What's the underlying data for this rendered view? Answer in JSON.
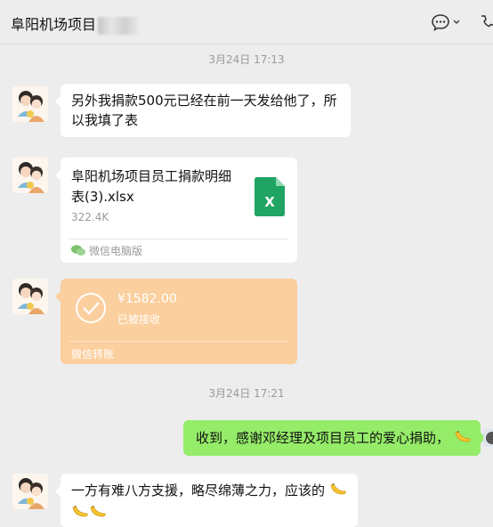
{
  "header": {
    "title": "阜阳机场项目",
    "title_hidden_suffix": "",
    "more_icon": "chat-bubble-more-icon",
    "extra_icon": "phone-icon"
  },
  "timestamps": [
    "3月24日 17:13",
    "3月24日 17:21"
  ],
  "messages": [
    {
      "text_line1": "另外我捐款500元已经在前一天发给他了，所",
      "text_line2": "以我填了表"
    },
    {
      "file": {
        "name_line1": "阜阳机场项目员工捐款明细",
        "name_line2": "表(3).xlsx",
        "size": "322.4K",
        "source": "微信电脑版",
        "icon": "excel-file-icon"
      }
    },
    {
      "transfer": {
        "amount": "¥1582.00",
        "status": "已被接收",
        "source": "微信转账",
        "icon": "check-circle-icon"
      }
    },
    {
      "text": "收到，感谢邓经理及项目员工的爱心捐助，"
    },
    {
      "text": "一方有难八方支援，略尽绵薄之力，应该的"
    }
  ],
  "colors": {
    "background": "#ededed",
    "sent_bubble": "#95ec69",
    "received_bubble": "#ffffff",
    "transfer_card": "#fbcf9e",
    "excel_green": "#1fa463"
  }
}
